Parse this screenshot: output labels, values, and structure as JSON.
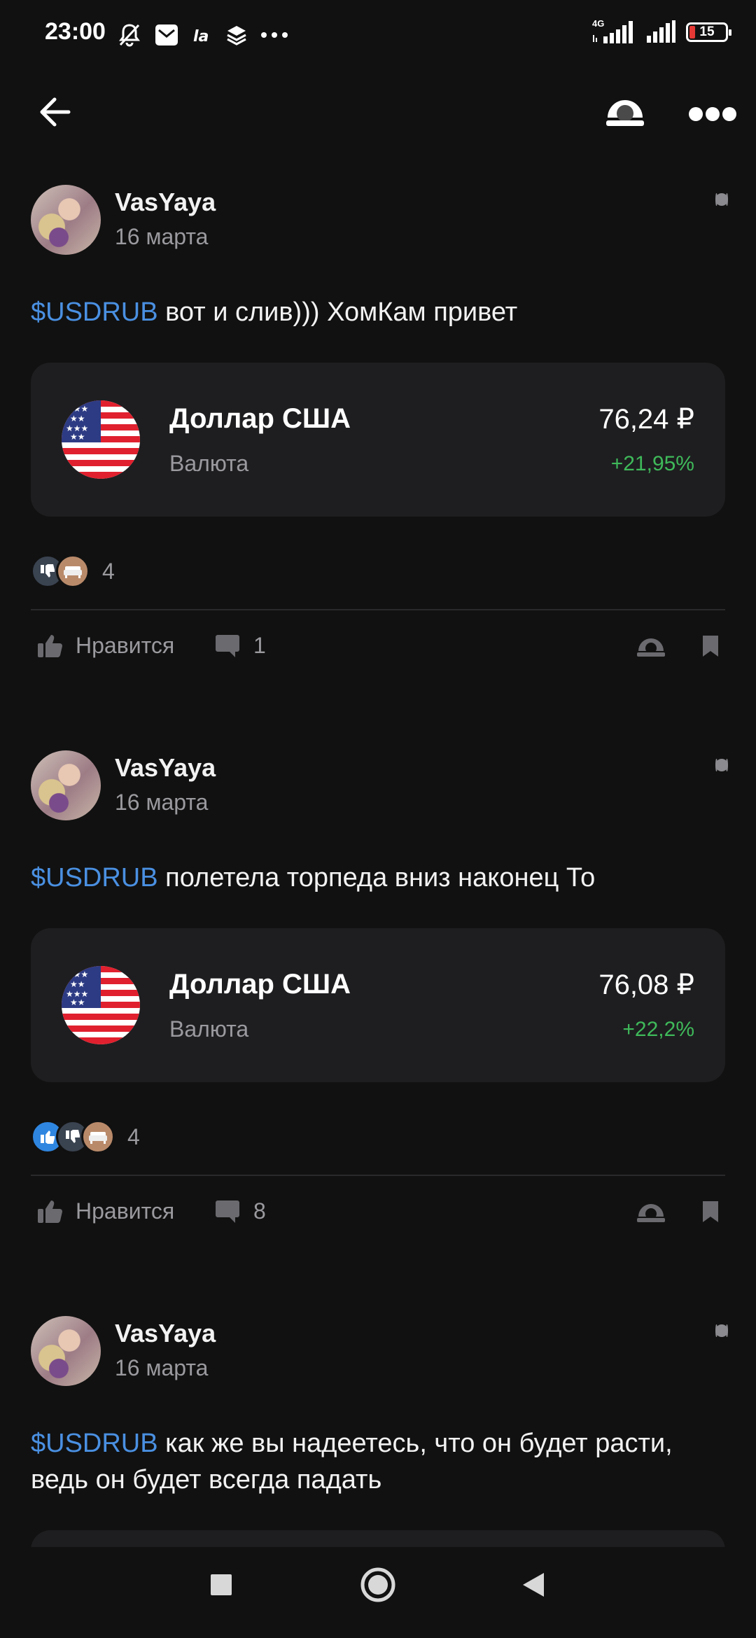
{
  "status_bar": {
    "time": "23:00",
    "left_icons": [
      "bell-off-icon",
      "mail-icon",
      "la-icon",
      "layers-icon",
      "more-dots-icon"
    ],
    "network": "4G",
    "battery": "15"
  },
  "top_bar": {
    "back_icon": "arrow-left-icon",
    "share_icon": "share-icon",
    "menu_icon": "more-dots-icon"
  },
  "posts": [
    {
      "author": "VasYaya",
      "date": "16 марта",
      "ticker": "$USDRUB",
      "text": " вот и слив))) ХомКам привет",
      "instrument": {
        "name": "Доллар США",
        "type": "Валюта",
        "price": "76,24 ₽",
        "change": "+21,95%"
      },
      "reactions": [
        "thumbs-down",
        "sofa"
      ],
      "reactions_count": "4",
      "like_label": "Нравится",
      "comments_count": "1"
    },
    {
      "author": "VasYaya",
      "date": "16 марта",
      "ticker": "$USDRUB",
      "text": " полетела торпеда вниз наконец То",
      "instrument": {
        "name": "Доллар США",
        "type": "Валюта",
        "price": "76,08 ₽",
        "change": "+22,2%"
      },
      "reactions": [
        "thumbs-up",
        "thumbs-down",
        "sofa"
      ],
      "reactions_count": "4",
      "like_label": "Нравится",
      "comments_count": "8"
    },
    {
      "author": "VasYaya",
      "date": "16 марта",
      "ticker": "$USDRUB",
      "text": " как же вы надеетесь, что он будет расти, ведь он будет всегда падать"
    }
  ],
  "nav_bar": {
    "recents_icon": "square-icon",
    "home_icon": "circle-icon",
    "back_icon": "triangle-back-icon"
  }
}
